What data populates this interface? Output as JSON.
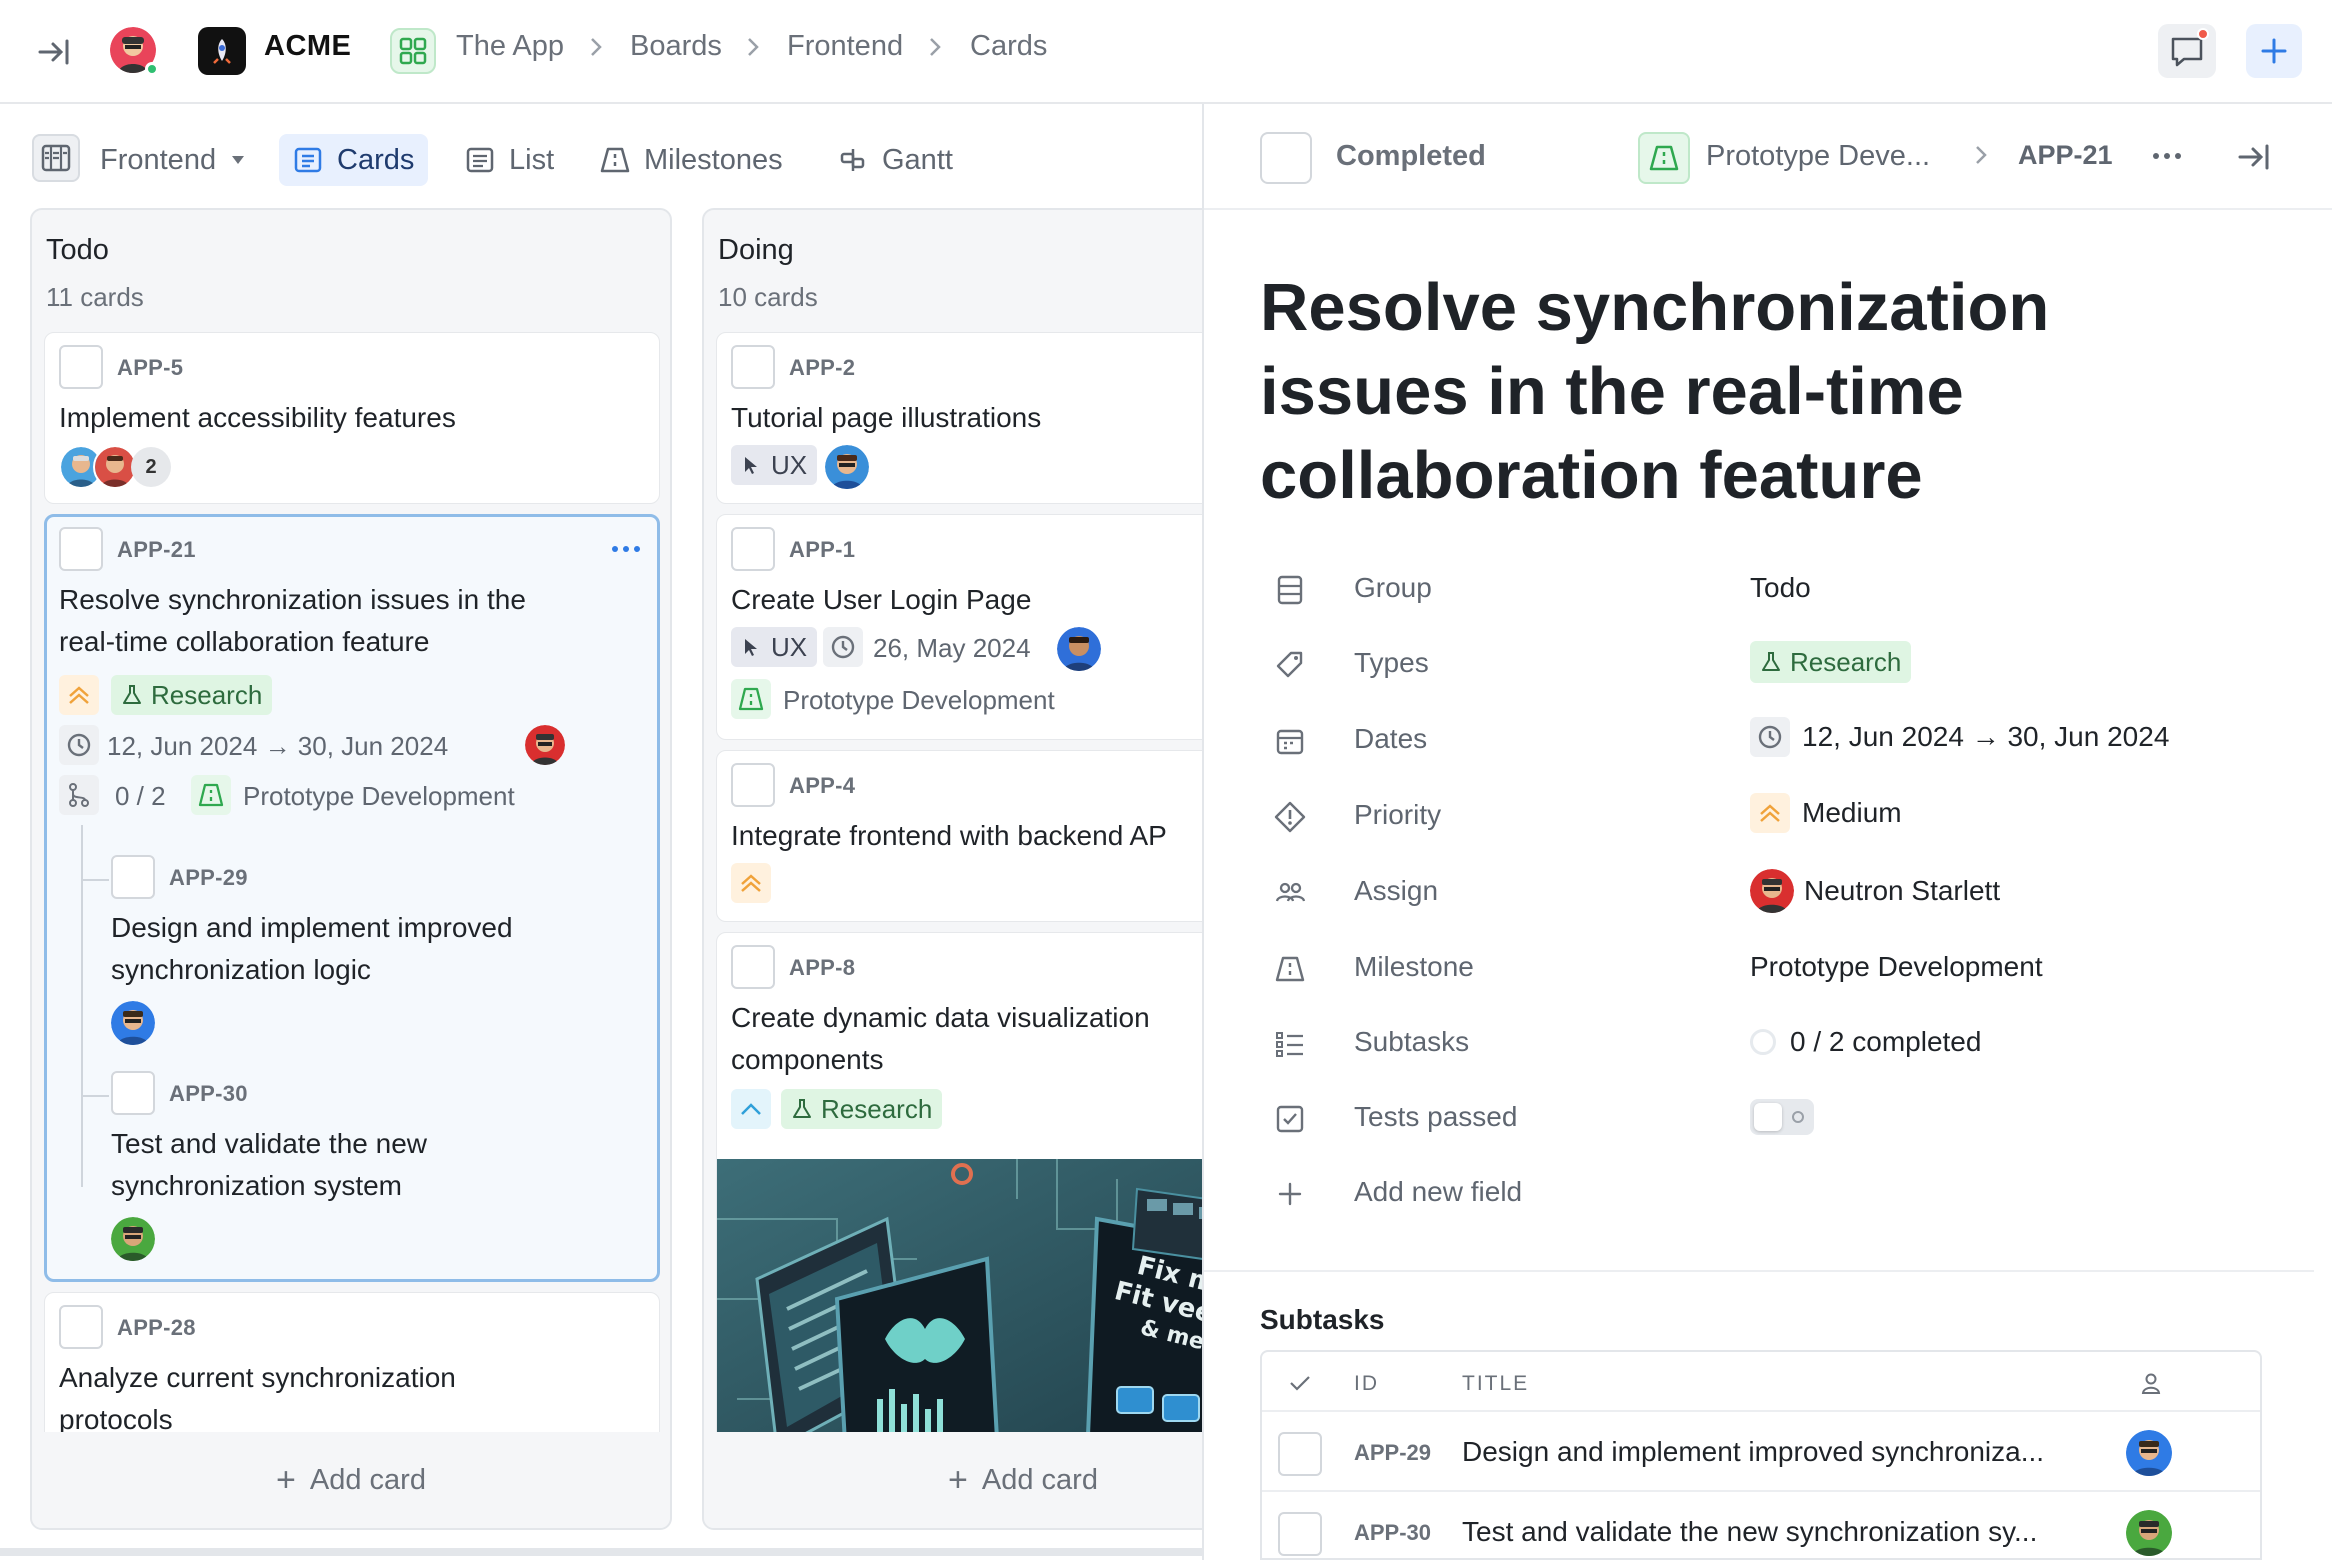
{
  "topbar": {
    "org_name": "ACME",
    "breadcrumbs": [
      "The App",
      "Boards",
      "Frontend",
      "Cards"
    ]
  },
  "views": {
    "board_selector": "Frontend",
    "tabs": [
      "Cards",
      "List",
      "Milestones",
      "Gantt"
    ],
    "active": "Cards"
  },
  "columns": [
    {
      "title": "Todo",
      "count": "11 cards",
      "add_label": "Add card",
      "cards": [
        {
          "id": "APP-5",
          "title": "Implement accessibility features",
          "assignee_extra": "2"
        },
        {
          "id": "APP-21",
          "title_lines": [
            "Resolve synchronization issues in the",
            "real-time collaboration feature"
          ],
          "tag": "Research",
          "dates": "12, Jun 2024 → 30, Jun 2024",
          "subtask_count": "0 / 2",
          "milestone": "Prototype Development",
          "subtasks": [
            {
              "id": "APP-29",
              "title_lines": [
                "Design and implement improved",
                "synchronization logic"
              ]
            },
            {
              "id": "APP-30",
              "title_lines": [
                "Test and validate the new",
                "synchronization system"
              ]
            }
          ]
        },
        {
          "id": "APP-28",
          "title_lines": [
            "Analyze current synchronization",
            "protocols"
          ]
        }
      ]
    },
    {
      "title": "Doing",
      "count": "10 cards",
      "add_label": "Add card",
      "cards": [
        {
          "id": "APP-2",
          "title": "Tutorial page illustrations",
          "tag": "UX"
        },
        {
          "id": "APP-1",
          "title": "Create User Login Page",
          "tag": "UX",
          "date": "26, May 2024",
          "milestone": "Prototype Development"
        },
        {
          "id": "APP-4",
          "title": "Integrate frontend with backend AP"
        },
        {
          "id": "APP-8",
          "title_lines": [
            "Create dynamic data visualization",
            "components"
          ],
          "tag": "Research"
        }
      ]
    }
  ],
  "panel": {
    "status": "Completed",
    "milestone_short": "Prototype Deve...",
    "id": "APP-21",
    "title": "Resolve synchronization issues in the real-time collaboration feature",
    "fields": [
      {
        "label": "Group",
        "value": "Todo"
      },
      {
        "label": "Types",
        "value": "Research"
      },
      {
        "label": "Dates",
        "value": "12, Jun 2024 → 30, Jun 2024"
      },
      {
        "label": "Priority",
        "value": "Medium"
      },
      {
        "label": "Assign",
        "value": "Neutron Starlett"
      },
      {
        "label": "Milestone",
        "value": "Prototype Development"
      },
      {
        "label": "Subtasks",
        "value": "0 / 2 completed"
      },
      {
        "label": "Tests passed",
        "value": ""
      }
    ],
    "add_field": "Add new field",
    "subtasks_header": "Subtasks",
    "table_headers": {
      "id": "ID",
      "title": "TITLE"
    },
    "subtask_rows": [
      {
        "id": "APP-29",
        "title": "Design and implement improved synchroniza..."
      },
      {
        "id": "APP-30",
        "title": "Test and validate the new synchronization sy..."
      }
    ]
  },
  "colors": {
    "accent": "#2f7be5",
    "research_bg": "#dff5e3",
    "priority_medium": "#f0a23a",
    "selected_border": "#8fbce8"
  }
}
